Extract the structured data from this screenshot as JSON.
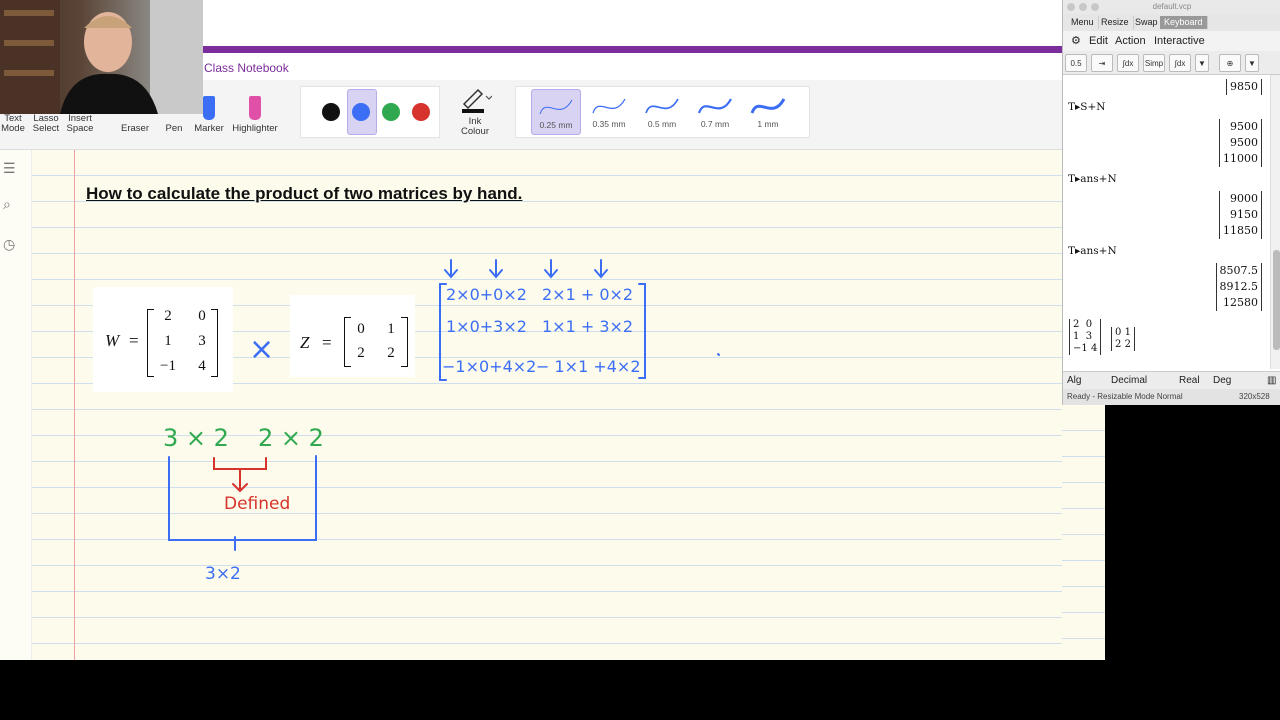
{
  "app": {
    "notebook_name": "Class Notebook"
  },
  "ribbon": {
    "tools": [
      {
        "label": "Text\nMode"
      },
      {
        "label": "Lasso\nSelect"
      },
      {
        "label": "Insert\nSpace"
      },
      {
        "label": "Eraser"
      },
      {
        "label": "Pen"
      },
      {
        "label": "Marker"
      },
      {
        "label": "Highlighter"
      }
    ],
    "ink_colors": [
      "#111111",
      "#3b6ef5",
      "#2fa84f",
      "#d6332c"
    ],
    "selected_ink_color": "#3b6ef5",
    "ink_colour_label": "Ink\nColour",
    "thicknesses": [
      "0.25 mm",
      "0.35 mm",
      "0.5 mm",
      "0.7 mm",
      "1 mm"
    ],
    "selected_thickness": "0.25 mm"
  },
  "page": {
    "title": "How to calculate the product of two matrices by hand.",
    "matrix_w": {
      "label": "W",
      "eq": "=",
      "rows": [
        [
          "2",
          "0"
        ],
        [
          "1",
          "3"
        ],
        [
          "−1",
          "4"
        ]
      ]
    },
    "matrix_z": {
      "label": "Z",
      "eq": "=",
      "rows": [
        [
          "0",
          "1"
        ],
        [
          "2",
          "2"
        ]
      ]
    },
    "handwriting": {
      "times_sign": "×",
      "product_rows": [
        [
          "2×0+0×2",
          "2×1 + 0×2"
        ],
        [
          "1×0+3×2",
          "1×1 + 3×2"
        ],
        [
          "−1×0+4×2",
          "− 1×1 +4×2"
        ]
      ],
      "dim_a": "3 × 2",
      "dim_b": "2 × 2",
      "defined": "Defined",
      "result_dim": "3×2"
    },
    "colors": {
      "green": "#2fa84f",
      "blue": "#3b6ef5",
      "red": "#d6332c"
    }
  },
  "calculator": {
    "titlebar": "default.vcp",
    "menu": [
      "Menu",
      "Resize",
      "Swap",
      "Keyboard"
    ],
    "active_menu": "Keyboard",
    "edit_menu": [
      "Edit",
      "Action",
      "Interactive"
    ],
    "toolbar_buttons": [
      "0.5",
      "⇥",
      "Simp",
      "∫dx",
      "▼",
      "⊕",
      "▼"
    ],
    "history": [
      {
        "expr": "",
        "result": [
          "9850"
        ]
      },
      {
        "expr": "T▸S+N",
        "result": [
          "9500",
          "9500",
          "11000"
        ]
      },
      {
        "expr": "T▸ans+N",
        "result": [
          "9000",
          "9150",
          "11850"
        ]
      },
      {
        "expr": "T▸ans+N",
        "result": [
          "8507.5",
          "8912.5",
          "12580"
        ]
      }
    ],
    "input_matrix_a": [
      [
        "2",
        "0"
      ],
      [
        "1",
        "3"
      ],
      [
        "−1",
        "4"
      ]
    ],
    "input_matrix_b": [
      [
        "0",
        "1"
      ],
      [
        "2",
        "2"
      ]
    ],
    "status": [
      "Alg",
      "Decimal",
      "Real",
      "Deg"
    ],
    "bottom_status": "Ready - Resizable Mode Normal",
    "bottom_size": "320x528"
  }
}
